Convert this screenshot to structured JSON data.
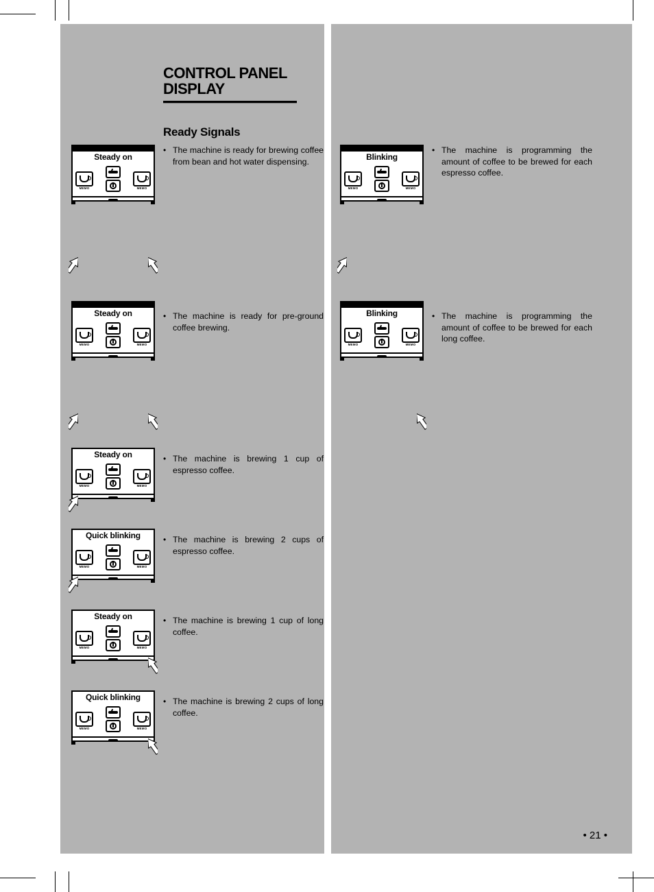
{
  "title_line1": "CONTROL PANEL",
  "title_line2": "DISPLAY",
  "section": "Ready Signals",
  "page_number": "• 21 •",
  "labels": {
    "steady": "Steady on",
    "blinking": "Blinking",
    "quick": "Quick blinking",
    "memo": "MEMO"
  },
  "bullets": {
    "b1": "The machine is ready for brewing coffee from bean and hot water dispensing.",
    "b2": "The machine is ready for pre-ground coffee brewing.",
    "b3": "The machine is brewing 1 cup of espresso coffee.",
    "b4": "The machine is brewing 2 cups of espresso coffee.",
    "b5": "The machine is brewing 1 cup of long coffee.",
    "b6": "The machine is brewing 2 cups of long coffee.",
    "b7": "The machine is programming the amount of coffee to be brewed for each espresso coffee.",
    "b8": "The machine is programming the amount of coffee to be brewed for each long coffee."
  }
}
